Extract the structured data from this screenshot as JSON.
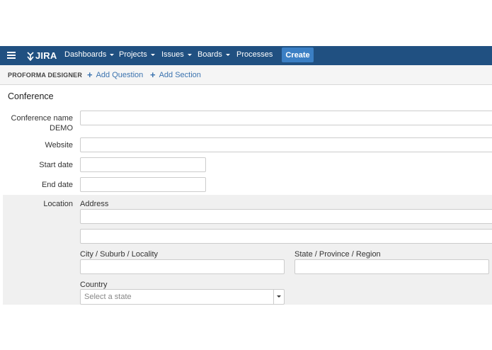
{
  "nav": {
    "logo": "JIRA",
    "items": [
      {
        "label": "Dashboards",
        "dropdown": true
      },
      {
        "label": "Projects",
        "dropdown": true
      },
      {
        "label": "Issues",
        "dropdown": true
      },
      {
        "label": "Boards",
        "dropdown": true
      },
      {
        "label": "Processes",
        "dropdown": false
      }
    ],
    "create_label": "Create",
    "colors": {
      "bar": "#205081",
      "create": "#3b7fc4"
    }
  },
  "toolbar": {
    "title": "PROFORMA DESIGNER",
    "add_question": "Add Question",
    "add_section": "Add Section"
  },
  "form": {
    "section_title": "Conference",
    "conference_name_label": "Conference name",
    "conference_name_sub": "DEMO",
    "website_label": "Website",
    "start_date_label": "Start date",
    "end_date_label": "End date",
    "location": {
      "label": "Location",
      "address_label": "Address",
      "city_label": "City / Suburb / Locality",
      "state_label": "State / Province / Region",
      "country_label": "Country",
      "country_placeholder": "Select a state"
    }
  }
}
